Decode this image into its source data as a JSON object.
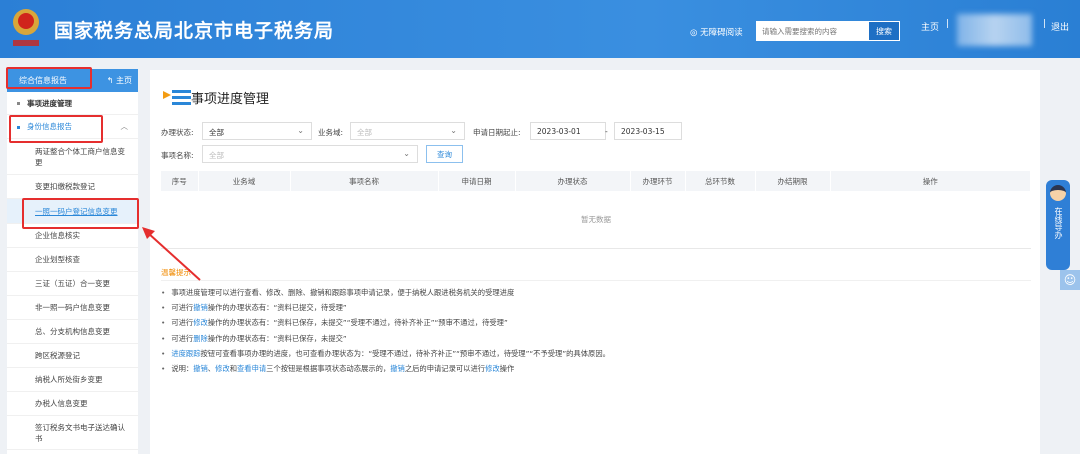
{
  "header": {
    "title": "国家税务总局北京市电子税务局",
    "logo_text": "中国税务",
    "accessibility": "无障碍阅读",
    "search_placeholder": "请输入需要搜索的内容",
    "search_button": "搜索",
    "home": "主页",
    "separator": "|",
    "logout": "退出"
  },
  "sidebar": {
    "header": "综合信息报告",
    "home": "主页",
    "items": [
      {
        "label": "事项进度管理"
      },
      {
        "label": "身份信息报告"
      }
    ],
    "subitems": [
      "两证整合个体工商户信息变更",
      "变更扣缴税款登记",
      "一照一码户登记信息变更",
      "企业信息核实",
      "企业划型核查",
      "三证（五证）合一变更",
      "非一照一码户信息变更",
      "总、分支机构信息变更",
      "跨区税源登记",
      "纳税人所处街乡变更",
      "办税人信息变更",
      "签订税务文书电子送达确认书"
    ]
  },
  "main": {
    "title": "事项进度管理",
    "filters": {
      "status_label": "办理状态:",
      "status_value": "全部",
      "domain_label": "业务域:",
      "domain_placeholder": "全部",
      "date_label": "申请日期起止:",
      "date_start": "2023-03-01",
      "date_dash": "-",
      "date_end": "2023-03-15",
      "name_label": "事项名称:",
      "name_placeholder": "全部",
      "query_button": "查询"
    },
    "table": {
      "headers": [
        "序号",
        "业务域",
        "事项名称",
        "申请日期",
        "办理状态",
        "办理环节",
        "总环节数",
        "办结期限",
        "操作"
      ],
      "empty": "暂无数据"
    },
    "tips_title": "温馨提示",
    "tips": [
      {
        "a": "事项进度管理可以进行查看、修改、删除、撤销和跟踪事项申请记录，便于纳税人跟进税务机关的受理进度"
      },
      {
        "a": "可进行",
        "b": "撤销",
        "c": "操作的办理状态有：“资料已提交，待受理”"
      },
      {
        "a": "可进行",
        "b": "修改",
        "c": "操作的办理状态有：“资料已保存，未提交”“受理不通过，待补齐补正”“预审不通过，待受理”"
      },
      {
        "a": "可进行",
        "b": "删除",
        "c": "操作的办理状态有：“资料已保存，未提交”"
      },
      {
        "b": "进度跟踪",
        "c": "按钮可查看事项办理的进度，也可查看办理状态为：“受理不通过，待补齐补正”“预审不通过，待受理”“不予受理”的具体原因。"
      },
      {
        "a": "说明：",
        "b": "撤销",
        "c": "、",
        "d": "修改",
        "e": "和",
        "f": "查看申请",
        "g": "三个按钮是根据事项状态动态展示的，",
        "h": "撤销",
        "i": "之后的申请记录可以进行",
        "j": "修改",
        "k": "操作"
      }
    ]
  },
  "float": {
    "label": "在线导办"
  },
  "colors": {
    "brand": "#2b7fd6",
    "accent": "#2a87d8",
    "warn": "#f08a00",
    "annotation": "#e52e2e"
  }
}
